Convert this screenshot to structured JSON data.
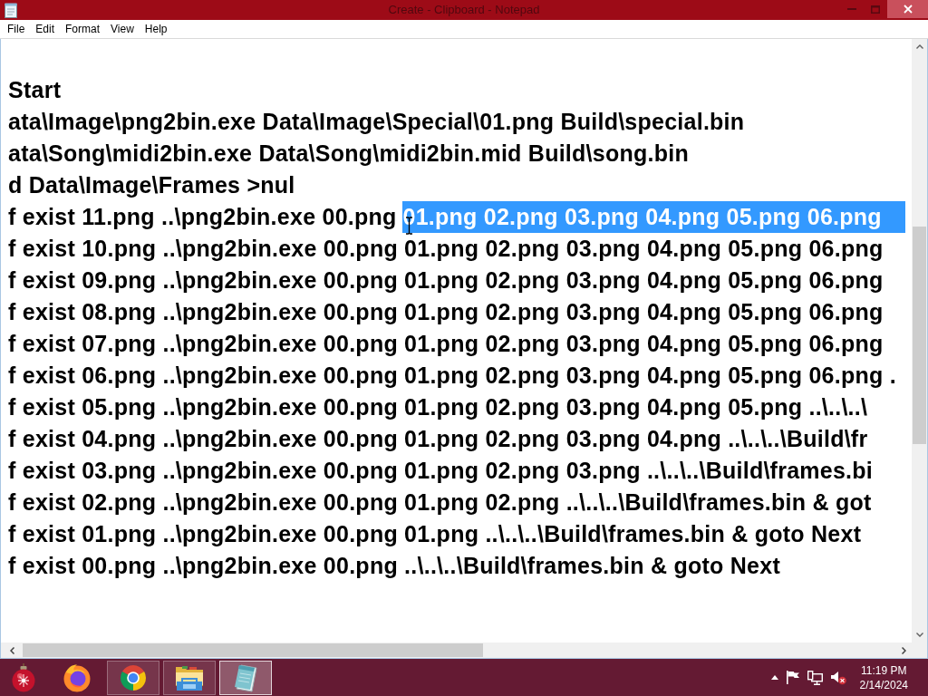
{
  "window": {
    "title": "Create - Clipboard - Notepad"
  },
  "menu": [
    "File",
    "Edit",
    "Format",
    "View",
    "Help"
  ],
  "editor": {
    "lines": [
      {
        "text": "Start"
      },
      {
        "text": "ata\\Image\\png2bin.exe Data\\Image\\Special\\01.png Build\\special.bin"
      },
      {
        "text": "ata\\Song\\midi2bin.exe Data\\Song\\midi2bin.mid Build\\song.bin"
      },
      {
        "text": "d Data\\Image\\Frames >nul"
      },
      {
        "text": "f exist 11.png ..\\png2bin.exe 00.png",
        "selection": "01.png 02.png 03.png 04.png 05.png 06.png"
      },
      {
        "text": "f exist 10.png ..\\png2bin.exe 00.png 01.png 02.png 03.png 04.png 05.png 06.png"
      },
      {
        "text": "f exist 09.png ..\\png2bin.exe 00.png 01.png 02.png 03.png 04.png 05.png 06.png"
      },
      {
        "text": "f exist 08.png ..\\png2bin.exe 00.png 01.png 02.png 03.png 04.png 05.png 06.png"
      },
      {
        "text": "f exist 07.png ..\\png2bin.exe 00.png 01.png 02.png 03.png 04.png 05.png 06.png"
      },
      {
        "text": "f exist 06.png ..\\png2bin.exe 00.png 01.png 02.png 03.png 04.png 05.png 06.png ."
      },
      {
        "text": "f exist 05.png ..\\png2bin.exe 00.png 01.png 02.png 03.png 04.png 05.png ..\\..\\..\\"
      },
      {
        "text": "f exist 04.png ..\\png2bin.exe 00.png 01.png 02.png 03.png 04.png ..\\..\\..\\Build\\fr"
      },
      {
        "text": "f exist 03.png ..\\png2bin.exe 00.png 01.png 02.png 03.png ..\\..\\..\\Build\\frames.bi"
      },
      {
        "text": "f exist 02.png ..\\png2bin.exe 00.png 01.png 02.png ..\\..\\..\\Build\\frames.bin & got"
      },
      {
        "text": "f exist 01.png ..\\png2bin.exe 00.png 01.png ..\\..\\..\\Build\\frames.bin & goto Next"
      },
      {
        "text": "f exist 00.png ..\\png2bin.exe 00.png ..\\..\\..\\Build\\frames.bin & goto Next"
      }
    ]
  },
  "taskbar": {
    "apps": [
      {
        "kind": "ornament",
        "open": false,
        "selected": false
      },
      {
        "kind": "firefox",
        "open": false,
        "selected": false
      },
      {
        "kind": "chrome",
        "open": true,
        "selected": false
      },
      {
        "kind": "files",
        "open": true,
        "selected": false
      },
      {
        "kind": "notepad",
        "open": true,
        "selected": true
      }
    ],
    "clock": {
      "time": "11:19 PM",
      "date": "2/14/2024"
    }
  }
}
